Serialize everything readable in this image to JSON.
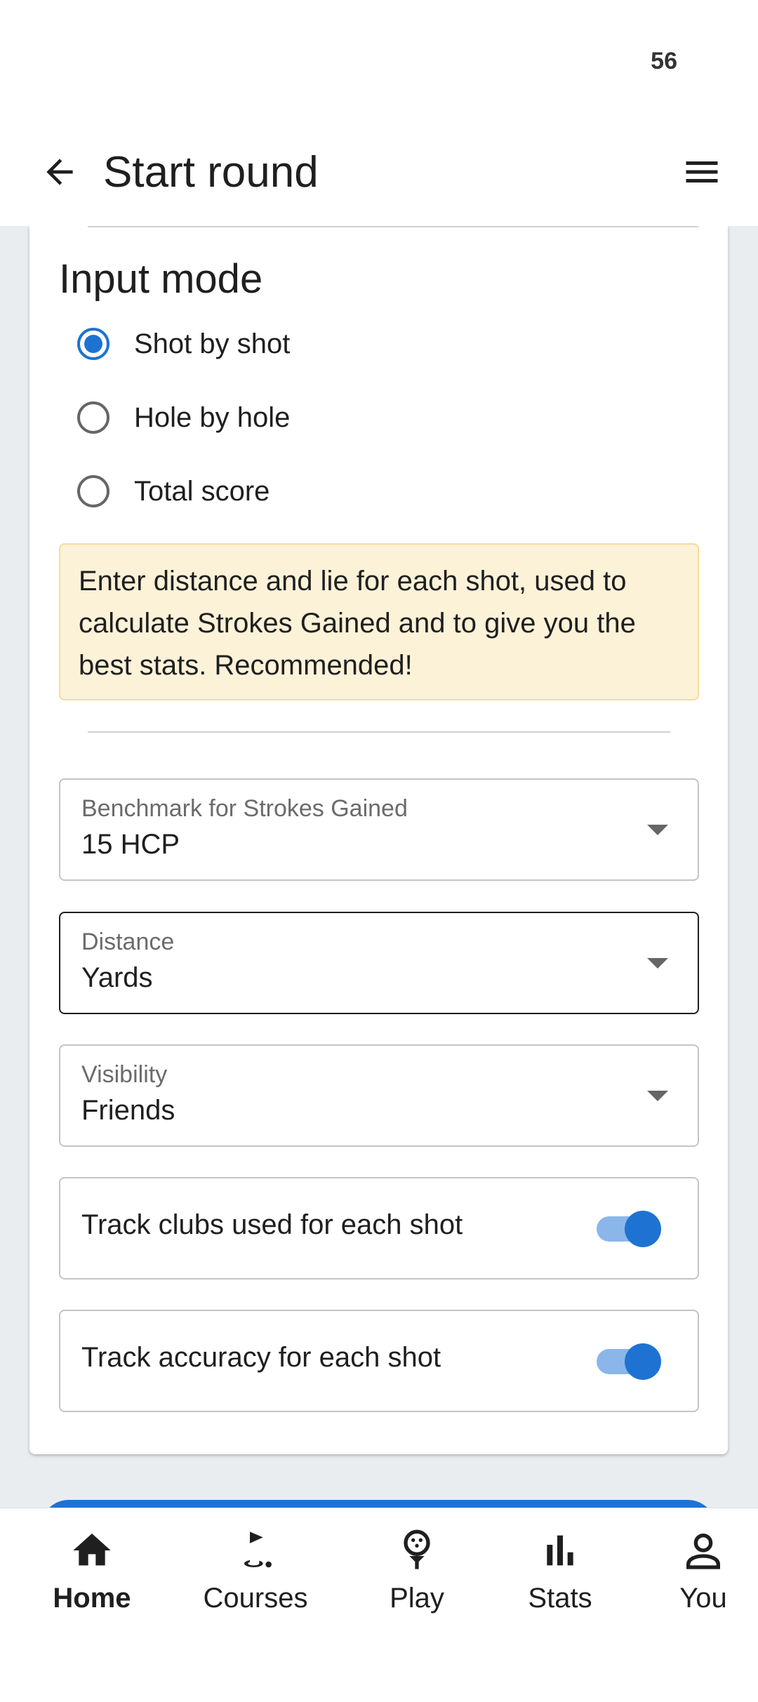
{
  "status_bar": {
    "time": "56"
  },
  "app_bar": {
    "title": "Start round"
  },
  "input_mode": {
    "title": "Input mode",
    "options": [
      {
        "label": "Shot by shot",
        "selected": true
      },
      {
        "label": "Hole by hole",
        "selected": false
      },
      {
        "label": "Total score",
        "selected": false
      }
    ],
    "info": "Enter distance and lie for each shot, used to calculate Strokes Gained and to give you the best stats. Recommended!"
  },
  "fields": {
    "benchmark": {
      "label": "Benchmark for Strokes Gained",
      "value": "15 HCP"
    },
    "distance": {
      "label": "Distance",
      "value": "Yards"
    },
    "visibility": {
      "label": "Visibility",
      "value": "Friends"
    }
  },
  "toggles": {
    "track_clubs": {
      "label": "Track clubs used for each shot",
      "on": true
    },
    "track_accuracy": {
      "label": "Track accuracy for each shot",
      "on": true
    }
  },
  "colors": {
    "accent": "#1e73d2",
    "info_bg": "#fcf2d8",
    "info_border": "#f6dd97",
    "content_bg": "#e9edf0"
  },
  "bottom_nav": {
    "items": [
      {
        "label": "Home",
        "icon": "home-icon",
        "active": true
      },
      {
        "label": "Courses",
        "icon": "golf-flag-icon",
        "active": false
      },
      {
        "label": "Play",
        "icon": "golf-ball-tee-icon",
        "active": false
      },
      {
        "label": "Stats",
        "icon": "bar-chart-icon",
        "active": false
      },
      {
        "label": "You",
        "icon": "person-icon",
        "active": false
      }
    ]
  }
}
